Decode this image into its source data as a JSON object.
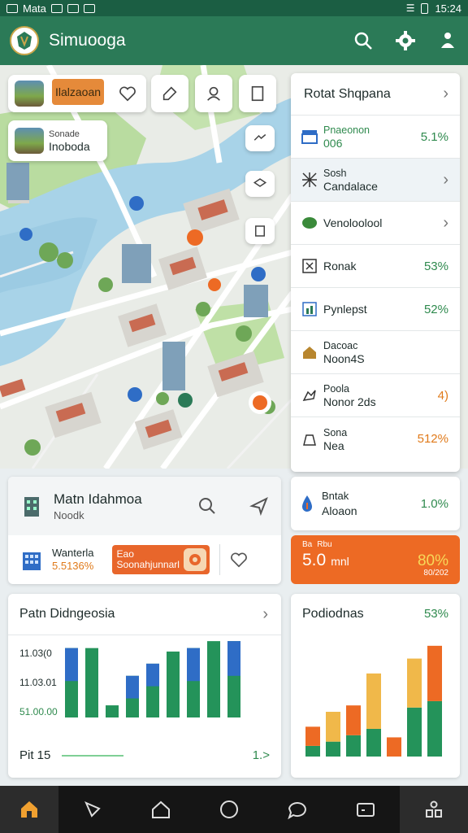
{
  "status_bar": {
    "carrier": "Mata",
    "time": "15:24"
  },
  "app": {
    "title": "Simuooga"
  },
  "map": {
    "top_card_pill": "Ilalzaoan",
    "info_card": {
      "line1": "Sonade",
      "line2": "Inoboda"
    }
  },
  "right_list": {
    "header": "Rotat Shqpana",
    "items": [
      {
        "line1": "Pnaeonon",
        "line2": "006",
        "value": "5.1%",
        "icon": "store-icon"
      },
      {
        "line1": "Sosh",
        "line2": "Candalace",
        "value": "",
        "icon": "lattice-icon",
        "chevron": true
      },
      {
        "line1": "",
        "line2": "Venoloolool",
        "value": "",
        "icon": "leaf-icon",
        "chevron": true
      },
      {
        "line1": "",
        "line2": "Ronak",
        "value": "53%",
        "icon": "grid-icon"
      },
      {
        "line1": "",
        "line2": "Pynlepst",
        "value": "52%",
        "icon": "chart-doc-icon"
      },
      {
        "line1": "Dacoac",
        "line2": "Noon4S",
        "value": "",
        "icon": "house-icon"
      },
      {
        "line1": "Poola",
        "line2": "Nonor 2ds",
        "value": "4)",
        "icon": "hand-icon",
        "value_color": "orange"
      },
      {
        "line1": "Sona",
        "line2": "Nea",
        "value": "512%",
        "icon": "shop-icon",
        "value_color": "orange"
      }
    ]
  },
  "main_card": {
    "title": "Matn Idahmoa",
    "subtitle": "Noodk",
    "row2_line1": "Wanterla",
    "row2_line2": "5.5136%",
    "button_line1": "Eao",
    "button_line2": "Soonahjunnarl"
  },
  "small_card": {
    "line1": "Bntak",
    "line2": "Aloaon",
    "value": "1.0%"
  },
  "orange_card": {
    "label1": "Ba",
    "label2": "Rbu",
    "big": "5.0",
    "unit": "mnl",
    "pct": "80%",
    "sub": "80/202"
  },
  "left_chart": {
    "title": "Patn Didngeosia",
    "ylabels": [
      "11.03(0",
      "11.03.01",
      "51.00.00"
    ],
    "foot_left": "Pit 15",
    "foot_right": "1.>"
  },
  "right_chart": {
    "title": "Podiodnas",
    "pct": "53%"
  },
  "colors": {
    "primary": "#2b7a57",
    "accent": "#ed6a24",
    "green_bar": "#24935a",
    "blue_bar": "#2f6dc6",
    "yellow_bar": "#f0b84a"
  },
  "chart_data": [
    {
      "type": "bar",
      "title": "Patn Didngeosia",
      "series": [
        {
          "values": [
            80,
            80,
            14,
            48,
            62,
            76,
            80,
            88,
            88
          ]
        },
        {
          "values": [
            38,
            0,
            0,
            26,
            26,
            0,
            38,
            0,
            40
          ]
        }
      ],
      "note": "stacked: series[0] green total-base, series[1] blue top segments"
    },
    {
      "type": "bar",
      "title": "Podiodnas",
      "series": [
        {
          "values": [
            18,
            28,
            28,
            52,
            18,
            46,
            52
          ]
        },
        {
          "values": [
            10,
            14,
            20,
            26,
            0,
            46,
            52
          ]
        }
      ]
    }
  ]
}
